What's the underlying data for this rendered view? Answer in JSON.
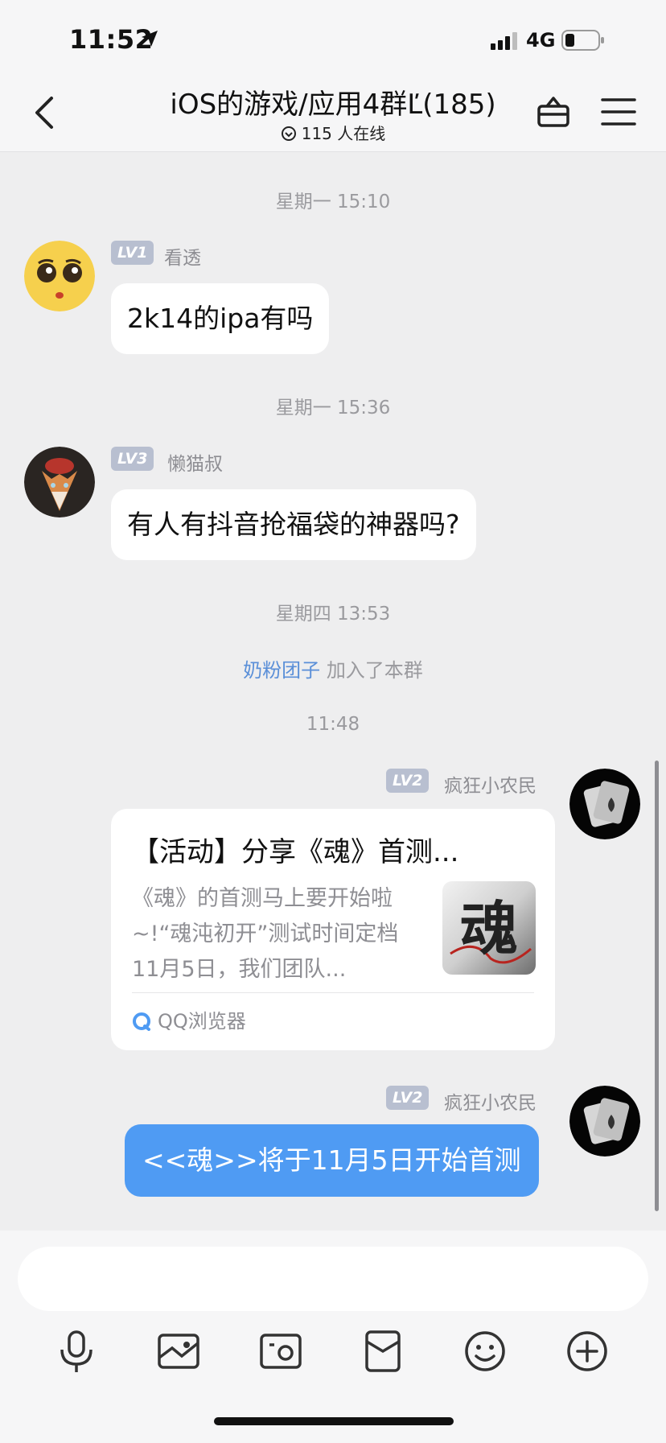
{
  "status_bar": {
    "time": "11:52",
    "network": "4G"
  },
  "nav": {
    "title": "iOS的游戏/应用4群Ľ(185)",
    "online": "115 人在线"
  },
  "timeline": [
    {
      "time": "星期一 15:10"
    },
    {
      "time": "星期一 15:36"
    },
    {
      "time": "星期四 13:53"
    },
    {
      "time": "11:48"
    }
  ],
  "messages": [
    {
      "level": "LV1",
      "sender": "看透",
      "text": "2k14的ipa有吗"
    },
    {
      "level": "LV3",
      "sender": "懒猫叔",
      "text": "有人有抖音抢福袋的神器吗?"
    },
    {
      "level": "LV2",
      "sender": "疯狂小农民",
      "card": {
        "title": "【活动】分享《魂》首测...",
        "desc": "《魂》的首测马上要开始啦~!“魂沌初开”测试时间定档11月5日，我们团队...",
        "thumb_text": "魂",
        "source": "QQ浏览器"
      }
    },
    {
      "level": "LV2",
      "sender": "疯狂小农民",
      "text": "<<魂>>将于11月5日开始首测"
    }
  ],
  "system": {
    "user": "奶粉团子",
    "action": "加入了本群"
  },
  "colors": {
    "accent": "#4f9bf3",
    "link": "#5a8fd8",
    "badge": "#b8bfd0",
    "background": "#eeeeef"
  },
  "icons": {
    "toolbar": [
      "microphone-icon",
      "image-icon",
      "camera-icon",
      "red-packet-icon",
      "emoji-icon",
      "plus-icon"
    ]
  }
}
